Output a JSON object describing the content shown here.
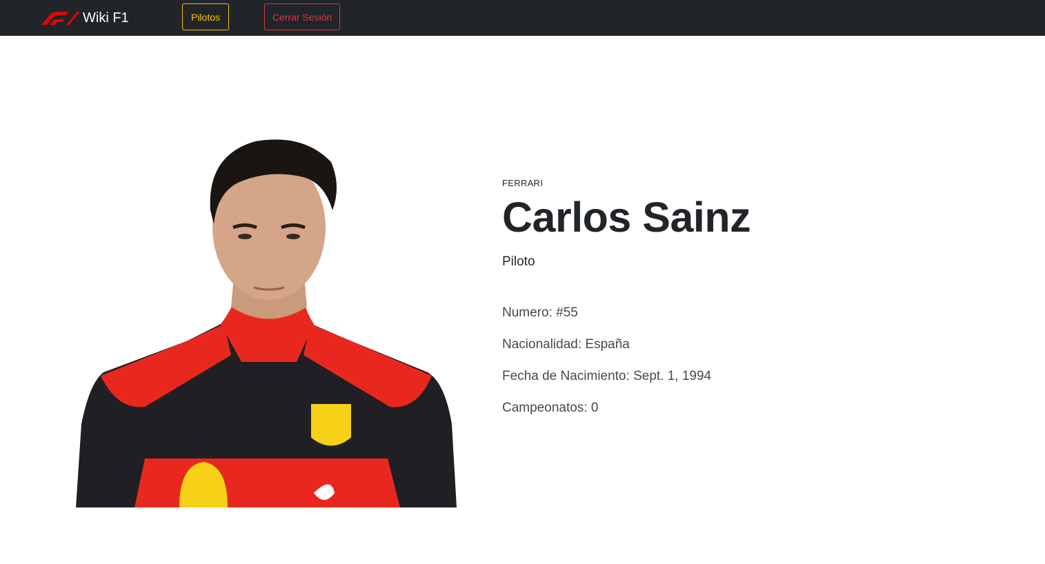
{
  "navbar": {
    "brand_text": "Wiki F1",
    "logo_icon": "f1-logo-icon",
    "pilotos_label": "Pilotos",
    "logout_label": "Cerrar Sesión",
    "colors": {
      "background": "#212529",
      "pilotos": "#ffc107",
      "logout": "#dc3545",
      "logo": "#e10600"
    }
  },
  "driver": {
    "team": "FERRARI",
    "name": "Carlos Sainz",
    "role": "Piloto",
    "facts": [
      "Numero: #55",
      "Nacionalidad: España",
      "Fecha de Nacimiento: Sept. 1, 1994",
      "Campeonatos: 0"
    ],
    "photo_icon": "driver-portrait-image"
  }
}
